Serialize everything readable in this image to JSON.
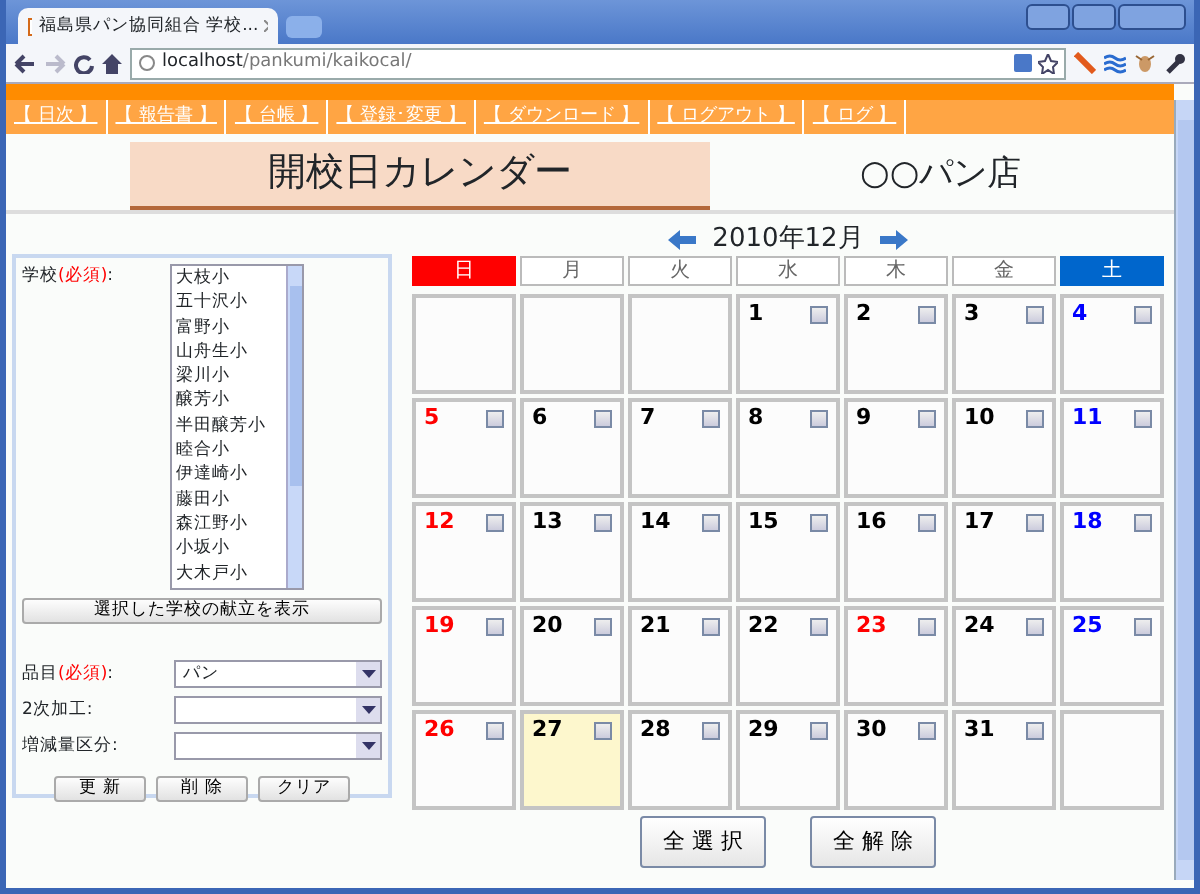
{
  "browser": {
    "tab_title": "福島県パン協同組合  学校...",
    "address_host": "localhost",
    "address_path": "/pankumi/kaikocal/"
  },
  "nav": [
    {
      "label": "【 日次 】"
    },
    {
      "label": "【 報告書 】"
    },
    {
      "label": "【 台帳 】"
    },
    {
      "label": "【 登録･変更 】"
    },
    {
      "label": "【 ダウンロード 】"
    },
    {
      "label": "【 ログアウト 】"
    },
    {
      "label": "【 ログ 】"
    }
  ],
  "page_title": "開校日カレンダー",
  "shop_name": "○○パン店",
  "school": {
    "label": "学校",
    "required_note": "(必須)",
    "suffix": ":",
    "options": [
      {
        "label": "大枝小",
        "selected": false
      },
      {
        "label": "五十沢小",
        "selected": false
      },
      {
        "label": "富野小",
        "selected": false
      },
      {
        "label": "山舟生小",
        "selected": false
      },
      {
        "label": "梁川小",
        "selected": false
      },
      {
        "label": "醸芳小",
        "selected": false
      },
      {
        "label": "半田醸芳小",
        "selected": false
      },
      {
        "label": "睦合小",
        "selected": false
      },
      {
        "label": "伊達崎小",
        "selected": false
      },
      {
        "label": "藤田小",
        "selected": false
      },
      {
        "label": "森江野小",
        "selected": false
      },
      {
        "label": "小坂小",
        "selected": false
      },
      {
        "label": "大木戸小",
        "selected": false
      }
    ],
    "show_button": "選択した学校の献立を表示"
  },
  "selects": [
    {
      "label": "品目",
      "required_note": "(必須)",
      "suffix": ":",
      "value": "パン"
    },
    {
      "label": "2次加工",
      "suffix": ":"
    },
    {
      "label": "増減量区分",
      "suffix": ":"
    }
  ],
  "form_buttons": [
    "更 新",
    "削 除",
    "クリア"
  ],
  "calendar": {
    "title": "2010年12月",
    "weekdays": [
      {
        "label": "日",
        "kind": "sun"
      },
      {
        "label": "月",
        "kind": "weekday"
      },
      {
        "label": "火",
        "kind": "weekday"
      },
      {
        "label": "水",
        "kind": "weekday"
      },
      {
        "label": "木",
        "kind": "weekday"
      },
      {
        "label": "金",
        "kind": "weekday"
      },
      {
        "label": "土",
        "kind": "sat"
      }
    ],
    "days": [
      {
        "kind": "empty"
      },
      {
        "kind": "empty"
      },
      {
        "kind": "empty"
      },
      {
        "kind": "day",
        "label": "1",
        "color": "#000000",
        "checked": false,
        "today": false
      },
      {
        "kind": "day",
        "label": "2",
        "color": "#000000",
        "checked": false,
        "today": false
      },
      {
        "kind": "day",
        "label": "3",
        "color": "#000000",
        "checked": false,
        "today": false
      },
      {
        "kind": "day",
        "label": "4",
        "color": "#0000ff",
        "checked": false,
        "today": false
      },
      {
        "kind": "day",
        "label": "5",
        "color": "#ff0000",
        "checked": false,
        "today": false
      },
      {
        "kind": "day",
        "label": "6",
        "color": "#000000",
        "checked": false,
        "today": false
      },
      {
        "kind": "day",
        "label": "7",
        "color": "#000000",
        "checked": false,
        "today": false
      },
      {
        "kind": "day",
        "label": "8",
        "color": "#000000",
        "checked": false,
        "today": false
      },
      {
        "kind": "day",
        "label": "9",
        "color": "#000000",
        "checked": false,
        "today": false
      },
      {
        "kind": "day",
        "label": "10",
        "color": "#000000",
        "checked": false,
        "today": false
      },
      {
        "kind": "day",
        "label": "11",
        "color": "#0000ff",
        "checked": false,
        "today": false
      },
      {
        "kind": "day",
        "label": "12",
        "color": "#ff0000",
        "checked": false,
        "today": false
      },
      {
        "kind": "day",
        "label": "13",
        "color": "#000000",
        "checked": false,
        "today": false
      },
      {
        "kind": "day",
        "label": "14",
        "color": "#000000",
        "checked": false,
        "today": false
      },
      {
        "kind": "day",
        "label": "15",
        "color": "#000000",
        "checked": false,
        "today": false
      },
      {
        "kind": "day",
        "label": "16",
        "color": "#000000",
        "checked": false,
        "today": false
      },
      {
        "kind": "day",
        "label": "17",
        "color": "#000000",
        "checked": false,
        "today": false
      },
      {
        "kind": "day",
        "label": "18",
        "color": "#0000ff",
        "checked": false,
        "today": false
      },
      {
        "kind": "day",
        "label": "19",
        "color": "#ff0000",
        "checked": false,
        "today": false
      },
      {
        "kind": "day",
        "label": "20",
        "color": "#000000",
        "checked": false,
        "today": false
      },
      {
        "kind": "day",
        "label": "21",
        "color": "#000000",
        "checked": false,
        "today": false
      },
      {
        "kind": "day",
        "label": "22",
        "color": "#000000",
        "checked": false,
        "today": false
      },
      {
        "kind": "day",
        "label": "23",
        "color": "#ff0000",
        "checked": false,
        "today": false
      },
      {
        "kind": "day",
        "label": "24",
        "color": "#000000",
        "checked": false,
        "today": false
      },
      {
        "kind": "day",
        "label": "25",
        "color": "#0000ff",
        "checked": false,
        "today": false
      },
      {
        "kind": "day",
        "label": "26",
        "color": "#ff0000",
        "checked": false,
        "today": false
      },
      {
        "kind": "day",
        "label": "27",
        "color": "#000000",
        "checked": false,
        "today": true
      },
      {
        "kind": "day",
        "label": "28",
        "color": "#000000",
        "checked": false,
        "today": false
      },
      {
        "kind": "day",
        "label": "29",
        "color": "#000000",
        "checked": false,
        "today": false
      },
      {
        "kind": "day",
        "label": "30",
        "color": "#000000",
        "checked": false,
        "today": false
      },
      {
        "kind": "day",
        "label": "31",
        "color": "#000000",
        "checked": false,
        "today": false
      },
      {
        "kind": "empty"
      }
    ],
    "buttons": [
      "全 選 択",
      "全 解 除"
    ]
  }
}
